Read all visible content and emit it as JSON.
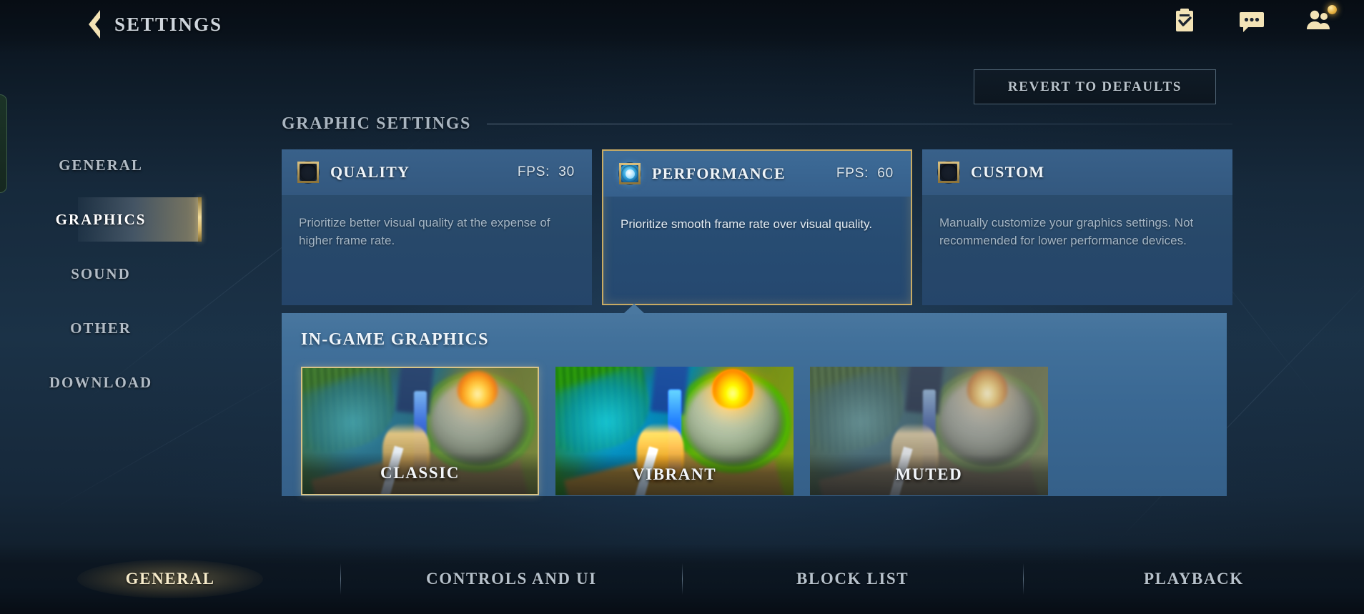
{
  "header": {
    "title": "SETTINGS",
    "back_icon": "back-chevron-icon",
    "icons": [
      {
        "name": "missions-clipboard-icon",
        "badge": false
      },
      {
        "name": "chat-bubble-icon",
        "badge": false
      },
      {
        "name": "friends-people-icon",
        "badge": true
      }
    ]
  },
  "revert": {
    "label": "REVERT TO DEFAULTS"
  },
  "sidebar": {
    "items": [
      {
        "label": "GENERAL",
        "active": false
      },
      {
        "label": "GRAPHICS",
        "active": true
      },
      {
        "label": "SOUND",
        "active": false
      },
      {
        "label": "OTHER",
        "active": false
      },
      {
        "label": "DOWNLOAD",
        "active": false
      }
    ]
  },
  "graphic_settings": {
    "section_title": "GRAPHIC SETTINGS",
    "fps_label": "FPS:",
    "presets": [
      {
        "name": "QUALITY",
        "fps": "30",
        "description": "Prioritize better visual quality at the expense of higher frame rate.",
        "selected": false
      },
      {
        "name": "PERFORMANCE",
        "fps": "60",
        "description": "Prioritize smooth frame rate over visual quality.",
        "selected": true
      },
      {
        "name": "CUSTOM",
        "fps": "",
        "description": "Manually customize your graphics settings. Not recommended for lower performance devices.",
        "selected": false
      }
    ]
  },
  "in_game_graphics": {
    "title": "IN-GAME GRAPHICS",
    "styles": [
      {
        "label": "CLASSIC",
        "selected": true
      },
      {
        "label": "VIBRANT",
        "selected": false
      },
      {
        "label": "MUTED",
        "selected": false
      }
    ]
  },
  "bottom_tabs": [
    {
      "label": "GENERAL",
      "active": true
    },
    {
      "label": "CONTROLS AND UI",
      "active": false
    },
    {
      "label": "BLOCK LIST",
      "active": false
    },
    {
      "label": "PLAYBACK",
      "active": false
    }
  ],
  "colors": {
    "gold": "#d9c487",
    "accent_blue": "#36a8e0",
    "panel_blue": "#3a6893",
    "card_blue": "#2b4d6d",
    "background": "#16293b"
  }
}
